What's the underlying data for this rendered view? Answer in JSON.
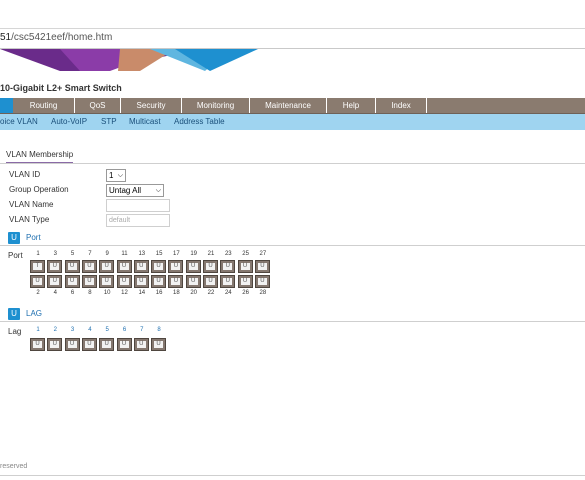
{
  "browser": {
    "url_host": "51",
    "url_path": "/csc5421eef/home.htm"
  },
  "product": {
    "title": "10-Gigabit L2+ Smart Switch"
  },
  "main_nav": [
    {
      "label": "Routing"
    },
    {
      "label": "QoS"
    },
    {
      "label": "Security"
    },
    {
      "label": "Monitoring"
    },
    {
      "label": "Maintenance"
    },
    {
      "label": "Help"
    },
    {
      "label": "Index"
    }
  ],
  "sub_nav": [
    {
      "label": "oice VLAN"
    },
    {
      "label": "Auto-VoIP"
    },
    {
      "label": "STP"
    },
    {
      "label": "Multicast"
    },
    {
      "label": "Address Table"
    }
  ],
  "tab": {
    "title": "VLAN Membership"
  },
  "form": {
    "vlan_id_label": "VLAN ID",
    "vlan_id_value": "1",
    "group_operation_label": "Group Operation",
    "group_operation_value": "Untag All",
    "vlan_name_label": "VLAN Name",
    "vlan_name_value": "",
    "vlan_type_label": "VLAN Type",
    "vlan_type_value": "default"
  },
  "port_section": {
    "icon_letter": "U",
    "title": "Port",
    "row_label": "Port",
    "top_numbers": [
      "1",
      "3",
      "5",
      "7",
      "9",
      "11",
      "13",
      "15",
      "17",
      "19",
      "21",
      "23",
      "25",
      "27"
    ],
    "bottom_numbers": [
      "2",
      "4",
      "6",
      "8",
      "10",
      "12",
      "14",
      "16",
      "18",
      "20",
      "22",
      "24",
      "26",
      "28"
    ],
    "top_states": [
      "T",
      "U",
      "U",
      "U",
      "U",
      "U",
      "U",
      "U",
      "U",
      "U",
      "U",
      "U",
      "U",
      "U"
    ],
    "bottom_states": [
      "U",
      "U",
      "U",
      "U",
      "U",
      "U",
      "U",
      "U",
      "U",
      "U",
      "U",
      "U",
      "U",
      "U"
    ]
  },
  "lag_section": {
    "icon_letter": "U",
    "title": "LAG",
    "row_label": "Lag",
    "numbers": [
      "1",
      "2",
      "3",
      "4",
      "5",
      "6",
      "7",
      "8"
    ],
    "states": [
      "U",
      "U",
      "U",
      "U",
      "U",
      "U",
      "U",
      "U"
    ]
  },
  "footer": {
    "text": "reserved"
  },
  "colors": {
    "nav_bg": "#8a7b6f",
    "nav_active": "#1e90d0",
    "sub_nav_bg": "#9fd4f0",
    "accent_blue": "#1e90d0",
    "tab_underline": "#8a6aa6",
    "port_body": "#857870"
  },
  "icons": [
    "chevron-down-icon",
    "untagged-icon",
    "port-icon"
  ]
}
